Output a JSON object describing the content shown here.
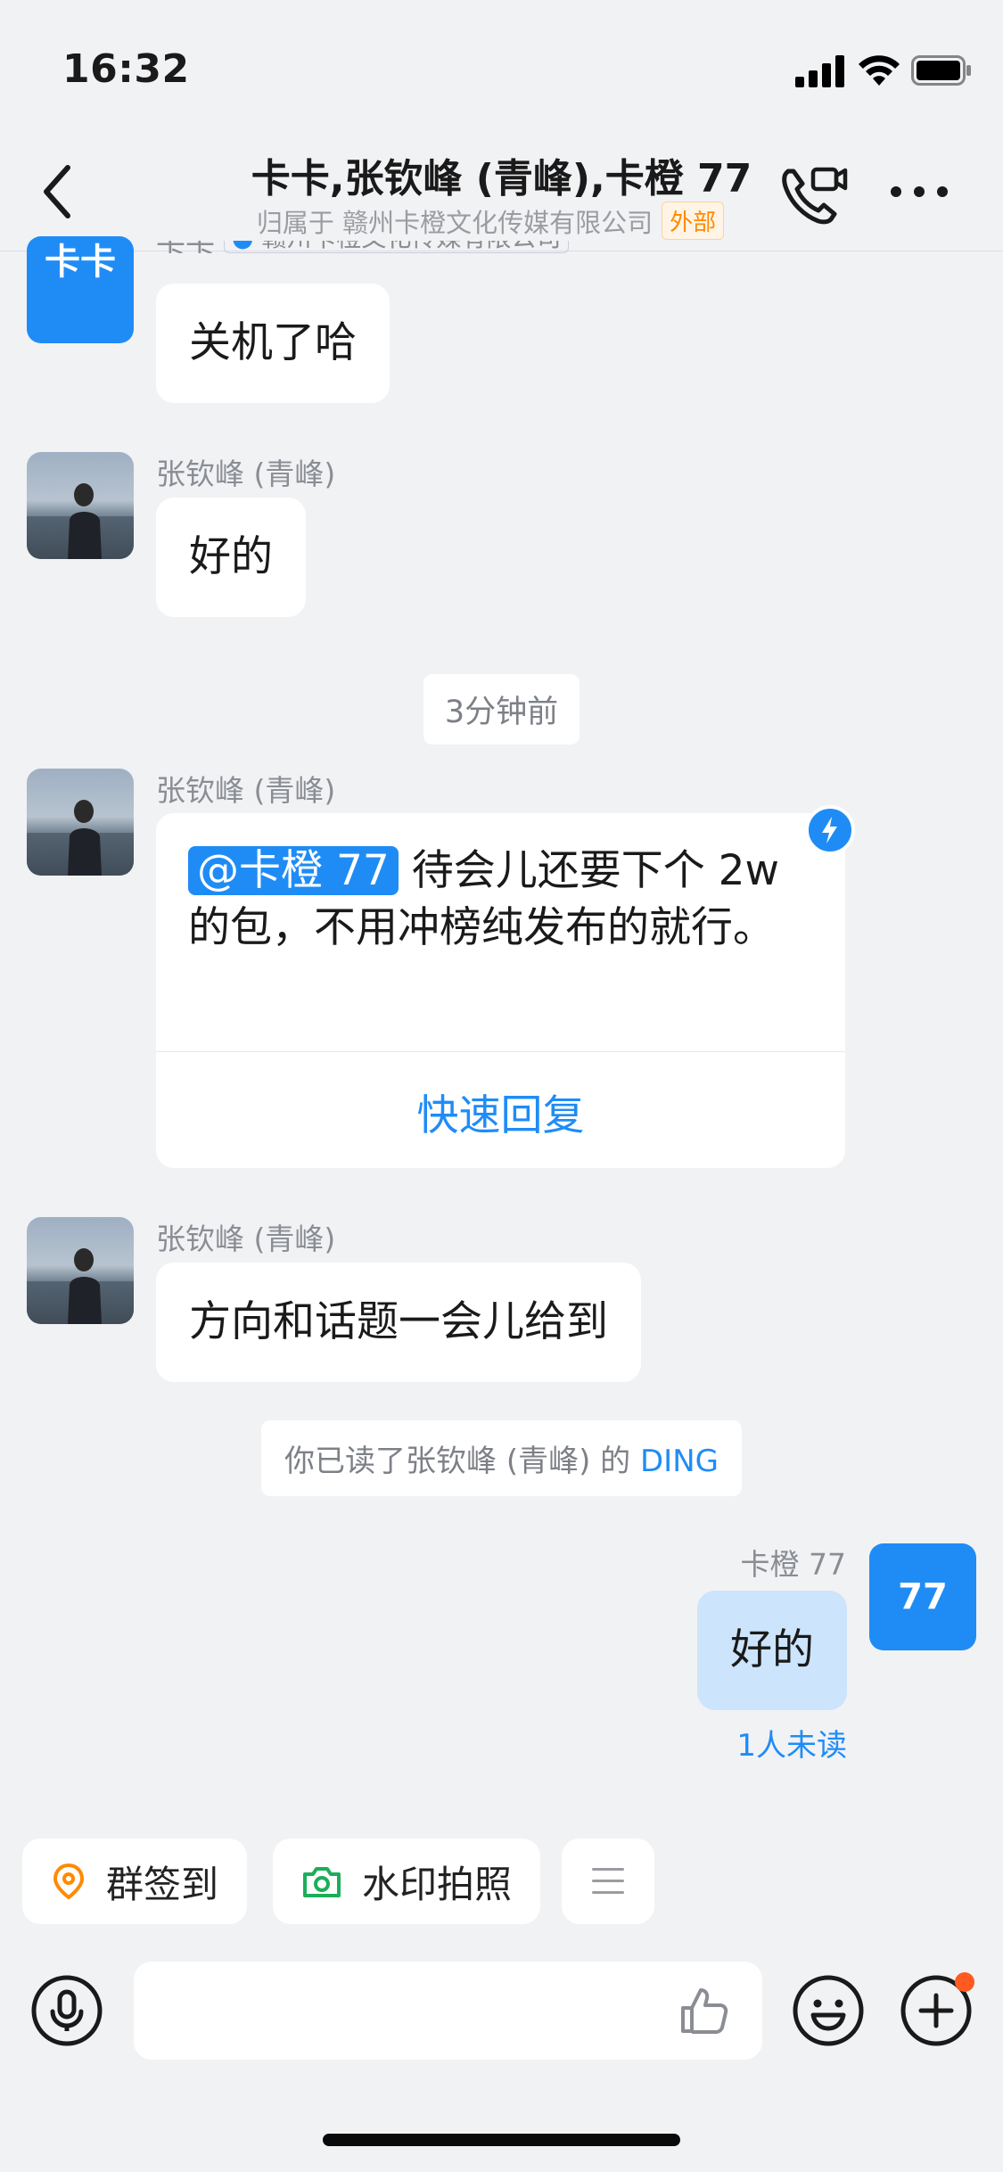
{
  "status_bar": {
    "time": "16:32"
  },
  "header": {
    "title": "卡卡,张钦峰 (青峰),卡橙 77",
    "subtitle_prefix": "归属于 赣州卡橙文化传媒有限公司",
    "badge": "外部",
    "cut_sender": "卡卡",
    "cut_org": "赣州卡橙文化传媒有限公司"
  },
  "messages": {
    "m1": {
      "avatar_text": "卡卡",
      "text": "关机了哈"
    },
    "m2": {
      "sender": "张钦峰 (青峰)",
      "text": "好的"
    },
    "time_divider": "3分钟前",
    "m3": {
      "sender": "张钦峰 (青峰)",
      "mention": "@卡橙 77",
      "text": " 待会儿还要下个 2w 的包，不用冲榜纯发布的就行。",
      "action": "快速回复"
    },
    "m4": {
      "sender": "张钦峰 (青峰)",
      "text": "方向和话题一会儿给到"
    },
    "system": {
      "text": "你已读了张钦峰 (青峰) 的",
      "link": "DING"
    },
    "m5": {
      "sender": "卡橙 77",
      "avatar_text": "77",
      "text": "好的",
      "read_status": "1人未读"
    }
  },
  "toolbar": {
    "checkin": "群签到",
    "watermark_photo": "水印拍照"
  },
  "colors": {
    "accent": "#1f8cf6",
    "background": "#f1f2f4",
    "self_bubble": "#cce4fc",
    "badge": "#ff8a00"
  },
  "icons": [
    "back-icon",
    "video-call-icon",
    "more-icon",
    "location-icon",
    "camera-icon",
    "menu-icon",
    "voice-icon",
    "thumbs-up-icon",
    "emoji-icon",
    "plus-icon"
  ]
}
